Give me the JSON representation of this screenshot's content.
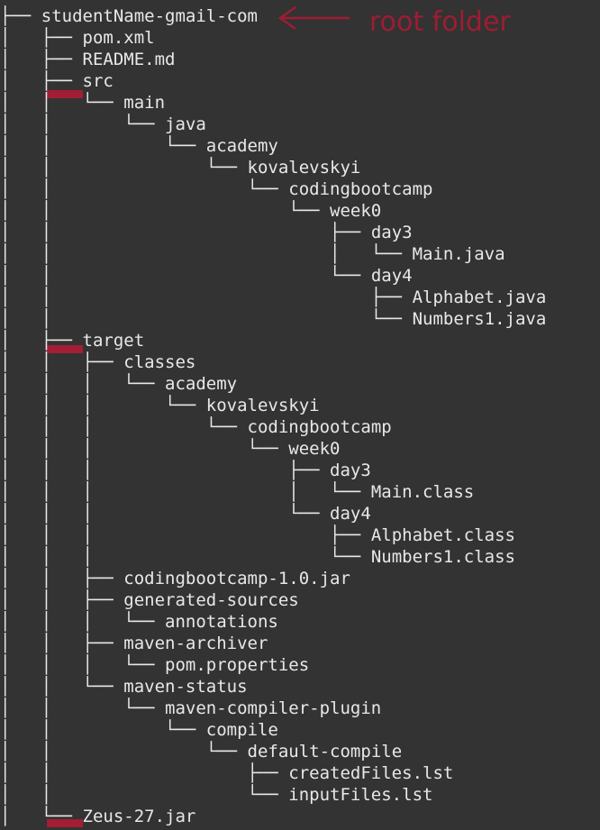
{
  "annotation": {
    "label": "root folder",
    "color": "#9e1c33"
  },
  "colors": {
    "background": "#333333",
    "text": "#e8e8e8",
    "marker": "#a31d35"
  },
  "tree": [
    {
      "prefix": "├── ",
      "name": "studentName-gmail-com"
    },
    {
      "prefix": "│   ├── ",
      "name": "pom.xml"
    },
    {
      "prefix": "│   ├── ",
      "name": "README.md"
    },
    {
      "prefix": "│   ├── ",
      "name": "src"
    },
    {
      "prefix": "│   │   └── ",
      "name": "main"
    },
    {
      "prefix": "│   │       └── ",
      "name": "java"
    },
    {
      "prefix": "│   │           └── ",
      "name": "academy"
    },
    {
      "prefix": "│   │               └── ",
      "name": "kovalevskyi"
    },
    {
      "prefix": "│   │                   └── ",
      "name": "codingbootcamp"
    },
    {
      "prefix": "│   │                       └── ",
      "name": "week0"
    },
    {
      "prefix": "│   │                           ├── ",
      "name": "day3"
    },
    {
      "prefix": "│   │                           │   └── ",
      "name": "Main.java"
    },
    {
      "prefix": "│   │                           └── ",
      "name": "day4"
    },
    {
      "prefix": "│   │                               ├── ",
      "name": "Alphabet.java"
    },
    {
      "prefix": "│   │                               └── ",
      "name": "Numbers1.java"
    },
    {
      "prefix": "│   ├── ",
      "name": "target"
    },
    {
      "prefix": "│   │   ├── ",
      "name": "classes"
    },
    {
      "prefix": "│   │   │   └── ",
      "name": "academy"
    },
    {
      "prefix": "│   │   │       └── ",
      "name": "kovalevskyi"
    },
    {
      "prefix": "│   │   │           └── ",
      "name": "codingbootcamp"
    },
    {
      "prefix": "│   │   │               └── ",
      "name": "week0"
    },
    {
      "prefix": "│   │   │                   ├── ",
      "name": "day3"
    },
    {
      "prefix": "│   │   │                   │   └── ",
      "name": "Main.class"
    },
    {
      "prefix": "│   │   │                   └── ",
      "name": "day4"
    },
    {
      "prefix": "│   │   │                       ├── ",
      "name": "Alphabet.class"
    },
    {
      "prefix": "│   │   │                       └── ",
      "name": "Numbers1.class"
    },
    {
      "prefix": "│   │   ├── ",
      "name": "codingbootcamp-1.0.jar"
    },
    {
      "prefix": "│   │   ├── ",
      "name": "generated-sources"
    },
    {
      "prefix": "│   │   │   └── ",
      "name": "annotations"
    },
    {
      "prefix": "│   │   ├── ",
      "name": "maven-archiver"
    },
    {
      "prefix": "│   │   │   └── ",
      "name": "pom.properties"
    },
    {
      "prefix": "│   │   └── ",
      "name": "maven-status"
    },
    {
      "prefix": "│   │       └── ",
      "name": "maven-compiler-plugin"
    },
    {
      "prefix": "│   │           └── ",
      "name": "compile"
    },
    {
      "prefix": "│   │               └── ",
      "name": "default-compile"
    },
    {
      "prefix": "│   │                   ├── ",
      "name": "createdFiles.lst"
    },
    {
      "prefix": "│   │                   └── ",
      "name": "inputFiles.lst"
    },
    {
      "prefix": "│   └── ",
      "name": "Zeus-27.jar"
    }
  ]
}
